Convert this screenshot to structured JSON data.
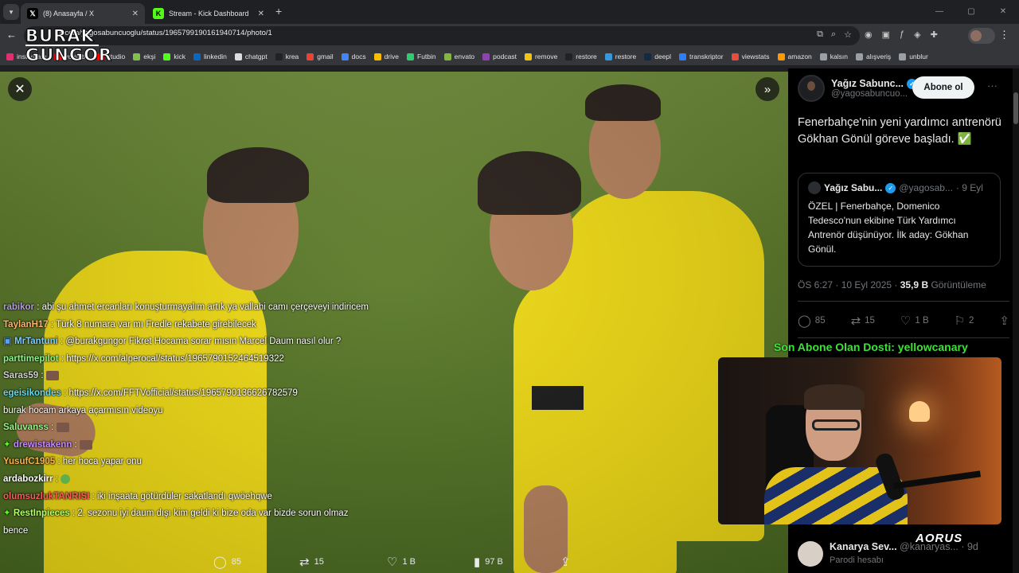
{
  "browser": {
    "tabs": [
      {
        "title": "(8) Anasayfa / X",
        "favicon": "X"
      },
      {
        "title": "Stream - Kick Dashboard",
        "favicon": "K"
      }
    ],
    "new_tab": "+",
    "url": "x.com/yagosabuncuoglu/status/1965799190161940714/photo/1",
    "url_prefix_hidden": "instagram",
    "window_controls": [
      "—",
      "▢",
      "✕"
    ]
  },
  "bookmarks": [
    {
      "label": "instagram",
      "color": "#e1306c"
    },
    {
      "label": "youtube",
      "color": "#ff0000"
    },
    {
      "label": "studio",
      "color": "#ff0000"
    },
    {
      "label": "ekşi",
      "color": "#81c14b"
    },
    {
      "label": "kick",
      "color": "#53fc18"
    },
    {
      "label": "linkedin",
      "color": "#0a66c2"
    },
    {
      "label": "chatgpt",
      "color": "#dddddd"
    },
    {
      "label": "krea",
      "color": "#222222"
    },
    {
      "label": "gmail",
      "color": "#ea4335"
    },
    {
      "label": "docs",
      "color": "#4285f4"
    },
    {
      "label": "drive",
      "color": "#fbbc04"
    },
    {
      "label": "Futbin",
      "color": "#2ecc71"
    },
    {
      "label": "envato",
      "color": "#82b541"
    },
    {
      "label": "podcast",
      "color": "#8e44ad"
    },
    {
      "label": "remove",
      "color": "#f1c40f"
    },
    {
      "label": "restore",
      "color": "#222222"
    },
    {
      "label": "restore",
      "color": "#3498db"
    },
    {
      "label": "deepl",
      "color": "#0f2b46"
    },
    {
      "label": "transkriptor",
      "color": "#2d7ff9"
    },
    {
      "label": "viewstats",
      "color": "#e74c3c"
    },
    {
      "label": "amazon",
      "color": "#ff9900"
    },
    {
      "label": "kalsın",
      "color": "#9aa0a6"
    },
    {
      "label": "alışveriş",
      "color": "#9aa0a6"
    },
    {
      "label": "unblur",
      "color": "#9aa0a6"
    }
  ],
  "watermark": {
    "line1": "BURAK",
    "line2": "GUNGOR"
  },
  "chat": [
    {
      "user": "rabikor",
      "color": "#b39ddb",
      "text": "abi şu ahmet ercanları konuşturmayalım artık ya vallahi camı çerçeveyi indiricem",
      "badge": ""
    },
    {
      "user": "TaylanH17",
      "color": "#ffb36b",
      "text": "Türk 8 numara var mı Fredle rekabete girebilecek",
      "badge": ""
    },
    {
      "user": "MrTantuni",
      "color": "#7ecbff",
      "text": "@burakgungor Fikret Hocama sorar mısın Marcel Daum nasıl olur ?",
      "badge": "sub"
    },
    {
      "user": "parttimepilot",
      "color": "#8bf58b",
      "text": "https://x.com/alperocal/status/1965790152464519322",
      "badge": ""
    },
    {
      "user": "Saras59",
      "color": "#d0d0d0",
      "text": "",
      "badge": "",
      "emote": "emote-icon"
    },
    {
      "user": "egeisikondes",
      "color": "#66d9ef",
      "text": "https://x.com/FFTVofficial/status/1965790136626782579",
      "badge": ""
    },
    {
      "user": "",
      "color": "#ffffff",
      "text": "burak hocam arkaya açarmısın videoyu",
      "badge": ""
    },
    {
      "user": "Saluvanss",
      "color": "#9cf28a",
      "text": "",
      "badge": "",
      "emote": "emote-icon"
    },
    {
      "user": "drewistakenn",
      "color": "#c58aff",
      "text": "",
      "badge": "gift",
      "emote": "emote-icon"
    },
    {
      "user": "YusufC1905",
      "color": "#ffb347",
      "text": "her hoca yapar onu",
      "badge": ""
    },
    {
      "user": "ardabozkirr",
      "color": "#ffffff",
      "text": "",
      "badge": "",
      "emote": "green-emote-icon"
    },
    {
      "user": "olumsuzlukTANRISI",
      "color": "#ff5a5a",
      "text": "iki inşaata götürdüler sakatlandı qwöehqwe",
      "badge": ""
    },
    {
      "user": "RestInpieces",
      "color": "#b5ff6b",
      "text": "2. sezonu iyi daum dışı kim geldi ki bize oda var bizde sorun olmaz bence",
      "badge": "gift"
    }
  ],
  "media_actions": {
    "replies": "85",
    "reposts": "15",
    "likes": "1 B",
    "views": "97 B"
  },
  "tweet": {
    "author_name": "Yağız Sabunc...",
    "author_handle": "@yagosabuncuo...",
    "follow_label": "Abone ol",
    "text": "Fenerbahçe'nin yeni yardımcı antrenörü Gökhan Gönül göreve başladı. ✅",
    "quote": {
      "name": "Yağız Sabu...",
      "handle": "@yagosab...",
      "date": "· 9 Eyl",
      "text": "ÖZEL | Fenerbahçe, Domenico Tedesco'nun ekibine Türk Yardımcı Antrenör düşünüyor. İlk aday: Gökhan Gönül."
    },
    "time": "ÖS 6:27 · 10 Eyl 2025 ·",
    "views_count": "35,9 B",
    "views_label": "Görüntüleme",
    "replies": "85",
    "reposts": "15",
    "likes": "1 B",
    "bookmarks": "2"
  },
  "sub_banner": "Son Abone Olan Dosti: yellowcanary",
  "reply": {
    "name": "Kanarya Sev...",
    "handle": "@kanaryas...",
    "time": "· 9d",
    "label": "Parodi hesabı"
  },
  "brand": "AORUS"
}
